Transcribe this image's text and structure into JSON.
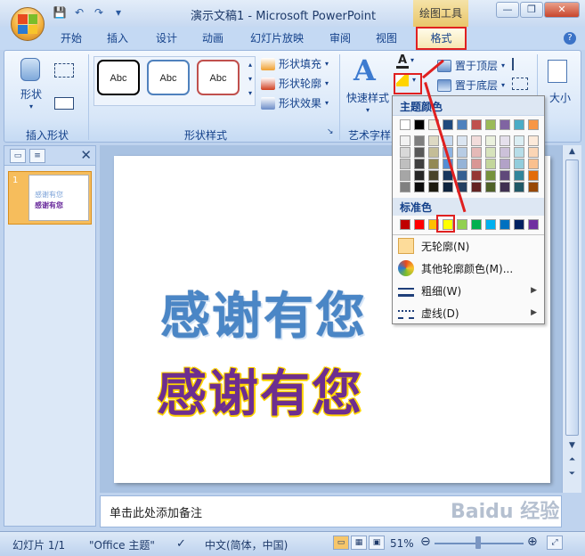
{
  "window": {
    "title": "演示文稿1 - Microsoft PowerPoint",
    "context_tab": "绘图工具"
  },
  "qat": {
    "save": "💾",
    "undo": "↶",
    "redo": "↷",
    "more": "▾"
  },
  "window_buttons": {
    "minimize": "—",
    "restore": "❐",
    "close": "✕"
  },
  "tabs": [
    "开始",
    "插入",
    "设计",
    "动画",
    "幻灯片放映",
    "审阅",
    "视图"
  ],
  "format_tab": "格式",
  "help": "?",
  "ribbon": {
    "insert_shape": {
      "shape_label": "形状",
      "group_label": "插入形状"
    },
    "shape_styles": {
      "abc": [
        "Abc",
        "Abc",
        "Abc"
      ],
      "abc_colors": [
        "#000000",
        "#4f81bd",
        "#c0504d"
      ],
      "fill": "形状填充",
      "outline": "形状轮廓",
      "effects": "形状效果",
      "group_label": "形状样式"
    },
    "wordart": {
      "quick_style": "快速样式",
      "group_label": "艺术字样"
    },
    "arrange": {
      "bring_front": "置于顶层",
      "send_back": "置于底层"
    },
    "size": {
      "label": "大小"
    }
  },
  "slides_pane": {
    "slide_number": "1",
    "thumb_line1": "感谢有您",
    "thumb_line2": "感谢有您"
  },
  "slide": {
    "text1": "感谢有您",
    "text2": "感谢有您"
  },
  "notes": {
    "placeholder": "单击此处添加备注"
  },
  "status": {
    "slide": "幻灯片 1/1",
    "theme": "\"Office 主题\"",
    "language": "中文(简体，中国)",
    "zoom": "51%"
  },
  "color_popup": {
    "theme_colors_label": "主题颜色",
    "theme_top_row": [
      "#ffffff",
      "#000000",
      "#eeece1",
      "#1f497d",
      "#4f81bd",
      "#c0504d",
      "#9bbb59",
      "#8064a2",
      "#4bacc6",
      "#f79646"
    ],
    "theme_shade_columns": [
      [
        "#f2f2f2",
        "#d9d9d9",
        "#bfbfbf",
        "#a6a6a6",
        "#808080"
      ],
      [
        "#7f7f7f",
        "#595959",
        "#3f3f3f",
        "#262626",
        "#0d0d0d"
      ],
      [
        "#ddd9c3",
        "#c4bd97",
        "#938953",
        "#494429",
        "#1d1b10"
      ],
      [
        "#c6d9f0",
        "#8db3e2",
        "#548dd4",
        "#17365d",
        "#0f243e"
      ],
      [
        "#dbe5f1",
        "#b8cce4",
        "#95b3d7",
        "#366092",
        "#244061"
      ],
      [
        "#f2dcdb",
        "#e5b9b7",
        "#d99694",
        "#953734",
        "#632423"
      ],
      [
        "#ebf1dd",
        "#d7e3bc",
        "#c3d69b",
        "#76923c",
        "#4f6128"
      ],
      [
        "#e5e0ec",
        "#ccc1d9",
        "#b2a2c7",
        "#5f497a",
        "#3f3151"
      ],
      [
        "#dbeef3",
        "#b7dde8",
        "#92cddc",
        "#31859b",
        "#205867"
      ],
      [
        "#fdeada",
        "#fbd5b5",
        "#fac08f",
        "#e36c09",
        "#974806"
      ]
    ],
    "standard_colors_label": "标准色",
    "standard_colors": [
      "#c00000",
      "#ff0000",
      "#ffc000",
      "#ffff00",
      "#92d050",
      "#00b050",
      "#00b0f0",
      "#0070c0",
      "#002060",
      "#7030a0"
    ],
    "no_outline": "无轮廓(N)",
    "more_colors": "其他轮廓颜色(M)...",
    "weight": "粗细(W)",
    "dashes": "虚线(D)"
  },
  "watermark": "Baidu 经验"
}
